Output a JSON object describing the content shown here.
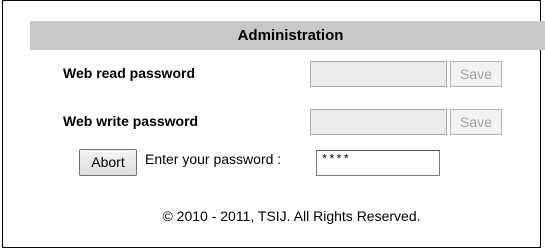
{
  "admin": {
    "title": "Administration",
    "read_password": {
      "label": "Web read password",
      "value": "",
      "save_label": "Save"
    },
    "write_password": {
      "label": "Web write password",
      "value": "",
      "save_label": "Save"
    },
    "auth": {
      "abort_label": "Abort",
      "prompt": "Enter your password :",
      "password_value": "****"
    },
    "footer": "© 2010 - 2011, TSIJ. All Rights Reserved."
  }
}
